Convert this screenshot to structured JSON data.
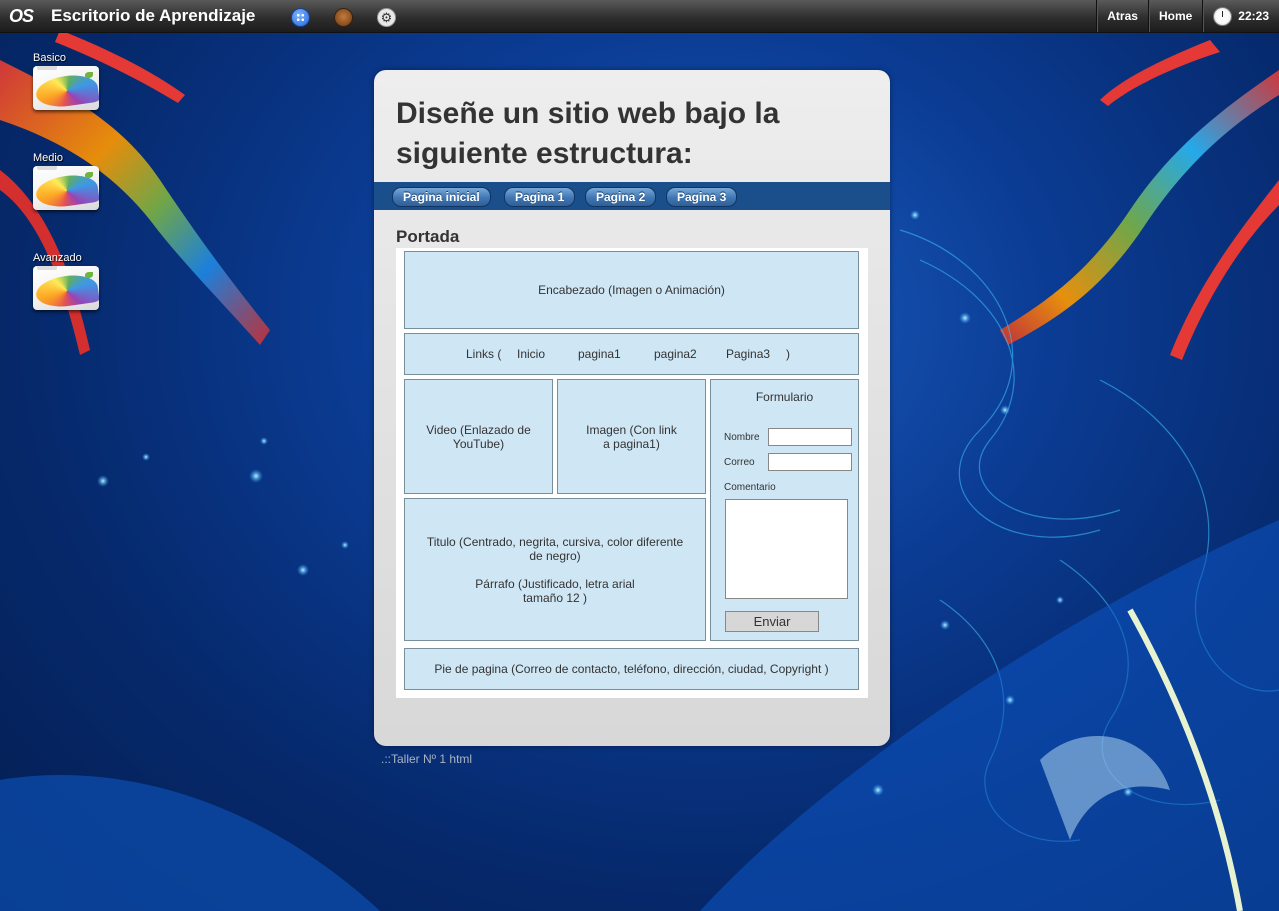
{
  "topbar": {
    "logo": "OS",
    "title": "Escritorio de Aprendizaje",
    "gear_glyph": "⚙",
    "buttons": {
      "back": "Atras",
      "home": "Home"
    },
    "clock": "22:23"
  },
  "desktop": {
    "icons": [
      {
        "label": "Basico",
        "icon": "folder-icon"
      },
      {
        "label": "Medio",
        "icon": "folder-icon"
      },
      {
        "label": "Avanzado",
        "icon": "folder-icon"
      }
    ]
  },
  "window": {
    "title": "Diseñe un sitio web bajo la siguiente estructura:",
    "nav": [
      "Pagina inicial",
      "Pagina 1",
      "Pagina 2",
      "Pagina 3"
    ],
    "section_title": "Portada",
    "diagram": {
      "header": "Encabezado (Imagen o Animación)",
      "links": [
        "Links (",
        "Inicio",
        "pagina1",
        "pagina2",
        "Pagina3",
        ")"
      ],
      "video": [
        "Video (Enlazado de",
        "YouTube)"
      ],
      "image": [
        "Imagen (Con link",
        "a pagina1)"
      ],
      "text": [
        "Titulo (Centrado, negrita, cursiva, color diferente",
        "de negro)",
        "Párrafo (Justificado, letra arial",
        "tamaño 12 )"
      ],
      "form": {
        "title": "Formulario",
        "name_label": "Nombre",
        "email_label": "Correo",
        "comment_label": "Comentario",
        "name_value": "",
        "email_value": "",
        "comment_value": "",
        "submit": "Enviar"
      },
      "footer": "Pie de pagina (Correo de contacto, teléfono, dirección, ciudad, Copyright )"
    }
  },
  "caption": ".::Taller Nº 1 html",
  "colors": {
    "navbar": "#1b4f8b",
    "diagram_cell": "#cfe6f4",
    "desktop": "#0b3c94"
  }
}
